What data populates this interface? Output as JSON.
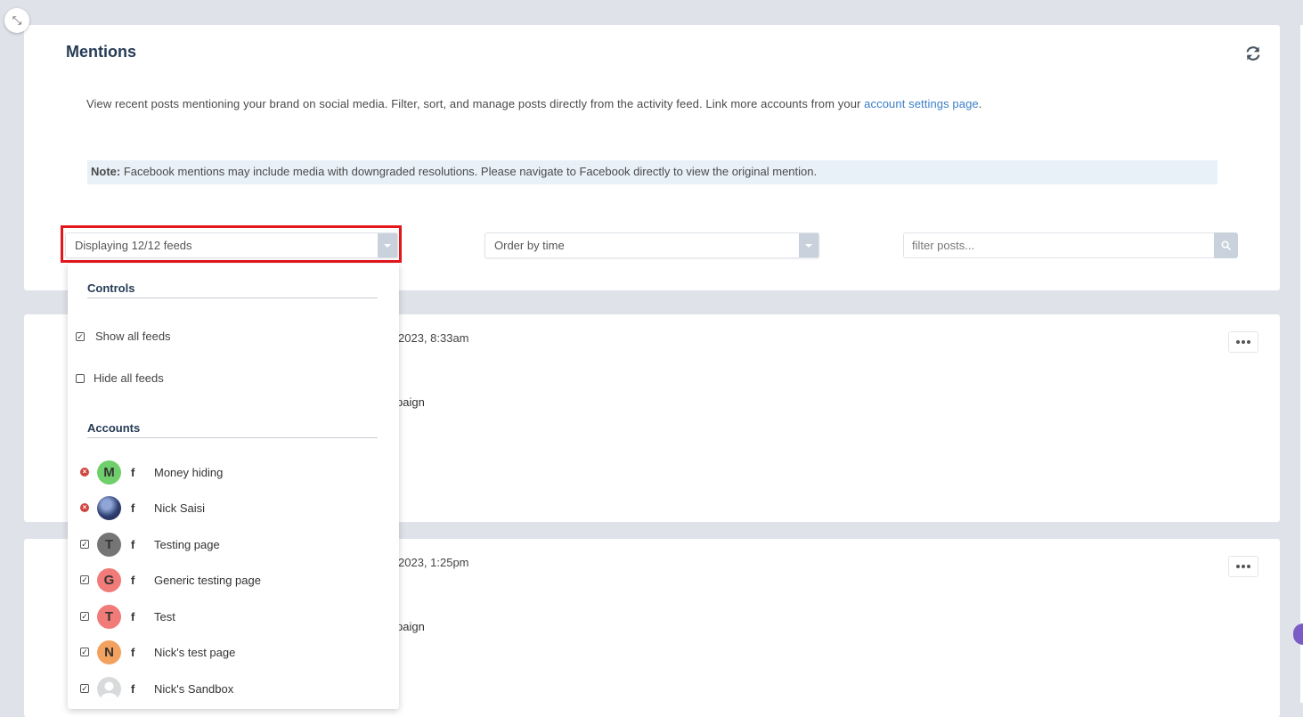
{
  "header": {
    "title": "Mentions",
    "description": "View recent posts mentioning your brand on social media. Filter, sort, and manage posts directly from the activity feed. Link more accounts from your",
    "settings_link": "account settings page",
    "description_end": ".",
    "note_label": "Note:",
    "note_text": "Facebook mentions may include media with downgraded resolutions. Please navigate to Facebook directly to view the original mention."
  },
  "filters": {
    "feeds_select": "Displaying 12/12 feeds",
    "order_select": "Order by time",
    "filter_placeholder": "filter posts..."
  },
  "dropdown": {
    "controls_heading": "Controls",
    "show_all": "Show all feeds",
    "hide_all": "Hide all feeds",
    "accounts_heading": "Accounts",
    "accounts": [
      {
        "name": "Money hiding",
        "initial": "M",
        "state": "error",
        "color": "#6fcf6a"
      },
      {
        "name": "Nick Saisi",
        "initial": "",
        "state": "error",
        "color": "#3b4a7a"
      },
      {
        "name": "Testing page",
        "initial": "T",
        "state": "checked",
        "color": "#757575"
      },
      {
        "name": "Generic testing page",
        "initial": "G",
        "state": "checked",
        "color": "#f07b78"
      },
      {
        "name": "Test",
        "initial": "T",
        "state": "checked",
        "color": "#f07b78"
      },
      {
        "name": "Nick's test page",
        "initial": "N",
        "state": "checked",
        "color": "#f3a15f"
      },
      {
        "name": "Nick's Sandbox",
        "initial": "",
        "state": "checked",
        "color": "#d9dadc"
      }
    ]
  },
  "posts": [
    {
      "date": "2023, 8:33am",
      "text": "paign"
    },
    {
      "date": "2023, 1:25pm",
      "text": "paign"
    }
  ]
}
